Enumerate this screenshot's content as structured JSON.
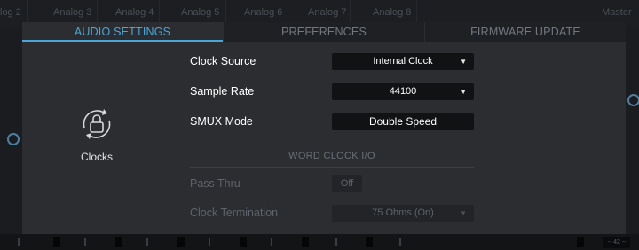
{
  "background": {
    "channel_tabs": [
      "log 2",
      "Analog 3",
      "Analog 4",
      "Analog 5",
      "Analog 6",
      "Analog 7",
      "Analog 8",
      "Master"
    ],
    "meter_readout": "-- 42 --"
  },
  "tabs": [
    {
      "label": "AUDIO SETTINGS",
      "active": true
    },
    {
      "label": "PREFERENCES",
      "active": false
    },
    {
      "label": "FIRMWARE UPDATE",
      "active": false
    }
  ],
  "clocks": {
    "icon": "lock-sync-icon",
    "label": "Clocks"
  },
  "settings": {
    "clock_source": {
      "label": "Clock Source",
      "value": "Internal Clock"
    },
    "sample_rate": {
      "label": "Sample Rate",
      "value": "44100"
    },
    "smux_mode": {
      "label": "SMUX Mode",
      "value": "Double Speed"
    }
  },
  "word_clock": {
    "title": "WORD CLOCK I/O",
    "pass_thru": {
      "label": "Pass Thru",
      "value": "Off"
    },
    "clock_termination": {
      "label": "Clock Termination",
      "value": "75 Ohms (On)"
    }
  },
  "colors": {
    "accent": "#4ba6d8",
    "modal_bg": "#2b2d31",
    "control_bg": "#111214"
  }
}
